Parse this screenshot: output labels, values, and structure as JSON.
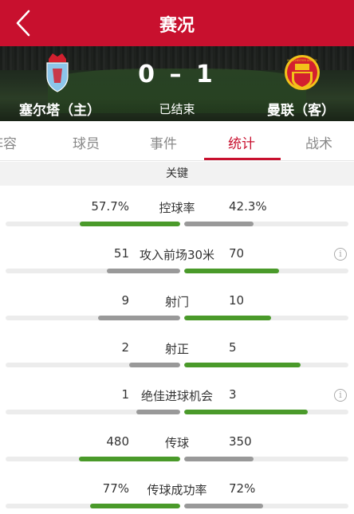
{
  "header": {
    "title": "赛况",
    "back_icon": "chevron-left-icon",
    "bg_color": "#c8102e"
  },
  "match": {
    "home_team": "塞尔塔（主）",
    "away_team": "曼联（客）",
    "score": "0 – 1",
    "status": "已结束",
    "home_crest": "celta-crest",
    "away_crest": "manchester-united-crest",
    "away_crest_text": "MANCHESTER UNITED"
  },
  "tabs": [
    {
      "label": "阵容",
      "active": false
    },
    {
      "label": "球员",
      "active": false
    },
    {
      "label": "事件",
      "active": false
    },
    {
      "label": "统计",
      "active": true
    },
    {
      "label": "战术",
      "active": false
    }
  ],
  "section_title": "关键",
  "colors": {
    "accent": "#c8102e",
    "better": "#4a9a2a",
    "worse": "#999999",
    "track": "#ececec"
  },
  "stats": [
    {
      "name": "控球率",
      "home": "57.7%",
      "away": "42.3%",
      "home_share": 0.577,
      "away_share": 0.423,
      "home_better": true,
      "info": false
    },
    {
      "name": "攻入前场30米",
      "home": "51",
      "away": "70",
      "home_share": 0.42,
      "away_share": 0.58,
      "home_better": false,
      "info": true
    },
    {
      "name": "射门",
      "home": "9",
      "away": "10",
      "home_share": 0.47,
      "away_share": 0.53,
      "home_better": false,
      "info": false
    },
    {
      "name": "射正",
      "home": "2",
      "away": "5",
      "home_share": 0.29,
      "away_share": 0.71,
      "home_better": false,
      "info": false
    },
    {
      "name": "绝佳进球机会",
      "home": "1",
      "away": "3",
      "home_share": 0.25,
      "away_share": 0.75,
      "home_better": false,
      "info": true
    },
    {
      "name": "传球",
      "home": "480",
      "away": "350",
      "home_share": 0.578,
      "away_share": 0.422,
      "home_better": true,
      "info": false
    },
    {
      "name": "传球成功率",
      "home": "77%",
      "away": "72%",
      "home_share": 0.517,
      "away_share": 0.483,
      "home_better": true,
      "info": false
    }
  ]
}
